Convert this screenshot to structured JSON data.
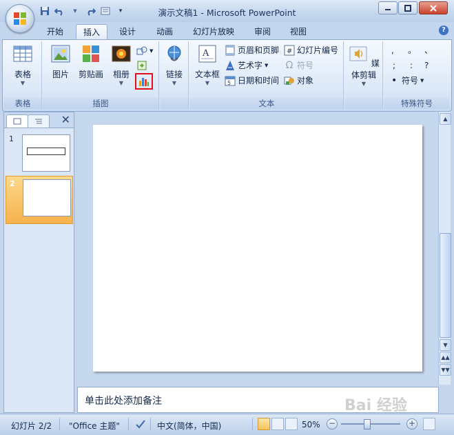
{
  "window": {
    "title": "演示文稿1 - Microsoft PowerPoint",
    "minimize_icon": "minimize-icon",
    "maximize_icon": "maximize-icon",
    "close_icon": "close-icon"
  },
  "quick_access": {
    "save_icon": "save-icon",
    "undo_icon": "undo-icon",
    "redo_icon": "redo-icon",
    "print_preview_icon": "print-preview-icon",
    "customize_icon": "chevron-down-icon"
  },
  "tabs": [
    "开始",
    "插入",
    "设计",
    "动画",
    "幻灯片放映",
    "审阅",
    "视图"
  ],
  "active_tab": "插入",
  "ribbon": {
    "groups": {
      "table": {
        "label": "表格",
        "buttons": {
          "table": "表格"
        }
      },
      "illustrations": {
        "label": "插图",
        "buttons": {
          "picture": "图片",
          "clipart": "剪贴画",
          "album": "相册"
        }
      },
      "links": {
        "label": "",
        "buttons": {
          "link": "链接"
        }
      },
      "text": {
        "label": "文本",
        "buttons": {
          "textbox": "文本框",
          "header_footer": "页眉和页脚",
          "wordart": "艺术字",
          "datetime": "日期和时间",
          "slide_number": "幻灯片编号",
          "symbol": "符号",
          "object": "对象"
        }
      },
      "media": {
        "label": "",
        "buttons": {
          "media": "媒体剪辑"
        }
      },
      "special_symbols": {
        "label": "特殊符号",
        "symbols": [
          ",",
          "。",
          "、",
          ";",
          ":",
          "?"
        ],
        "buttons": {
          "symbol": "符号"
        }
      }
    },
    "highlight_color": "#e0101a"
  },
  "slides_pane": {
    "slides": [
      {
        "number": "1",
        "selected": false
      },
      {
        "number": "2",
        "selected": true
      }
    ]
  },
  "notes": {
    "placeholder": "单击此处添加备注"
  },
  "statusbar": {
    "slide_info": "幻灯片 2/2",
    "theme": "\"Office 主题\"",
    "language": "中文(简体，中国)",
    "zoom": "50%",
    "zoom_percent": 50
  },
  "watermark": "Bai 经验"
}
